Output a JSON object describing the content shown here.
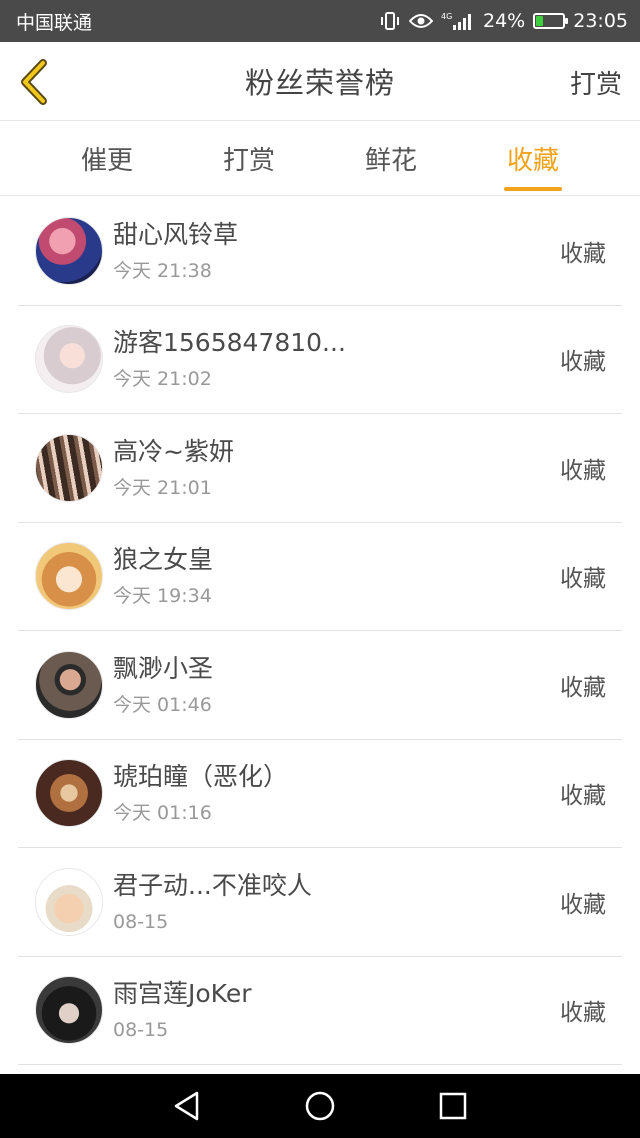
{
  "status_bar": {
    "carrier": "中国联通",
    "network": "4G",
    "battery": "24%",
    "battery_level": 0.24,
    "time": "23:05",
    "icons": [
      "vibrate-icon",
      "eye-icon",
      "signal-icon",
      "battery-icon"
    ]
  },
  "header": {
    "back_icon": "chevron-left-icon",
    "title": "粉丝荣誉榜",
    "action": "打赏"
  },
  "tabs": [
    {
      "label": "催更",
      "active": false
    },
    {
      "label": "打赏",
      "active": false
    },
    {
      "label": "鲜花",
      "active": false
    },
    {
      "label": "收藏",
      "active": true
    }
  ],
  "list": [
    {
      "name": "甜心风铃草",
      "time": "今天 21:38",
      "action": "收藏"
    },
    {
      "name": "游客1565847810...",
      "time": "今天 21:02",
      "action": "收藏"
    },
    {
      "name": "高冷~紫妍",
      "time": "今天 21:01",
      "action": "收藏"
    },
    {
      "name": "狼之女皇",
      "time": "今天 19:34",
      "action": "收藏"
    },
    {
      "name": "飘渺小圣",
      "time": "今天 01:46",
      "action": "收藏"
    },
    {
      "name": "琥珀瞳（恶化）",
      "time": "今天 01:16",
      "action": "收藏"
    },
    {
      "name": "君子动...不准咬人",
      "time": "08-15",
      "action": "收藏"
    },
    {
      "name": "雨宫莲JoKer",
      "time": "08-15",
      "action": "收藏"
    }
  ],
  "colors": {
    "accent": "#f2a21b",
    "status_bar_bg": "#4a4a4a",
    "nav_bar_bg": "#000000"
  },
  "nav_bar": [
    "back-triangle-icon",
    "home-circle-icon",
    "recents-square-icon"
  ]
}
